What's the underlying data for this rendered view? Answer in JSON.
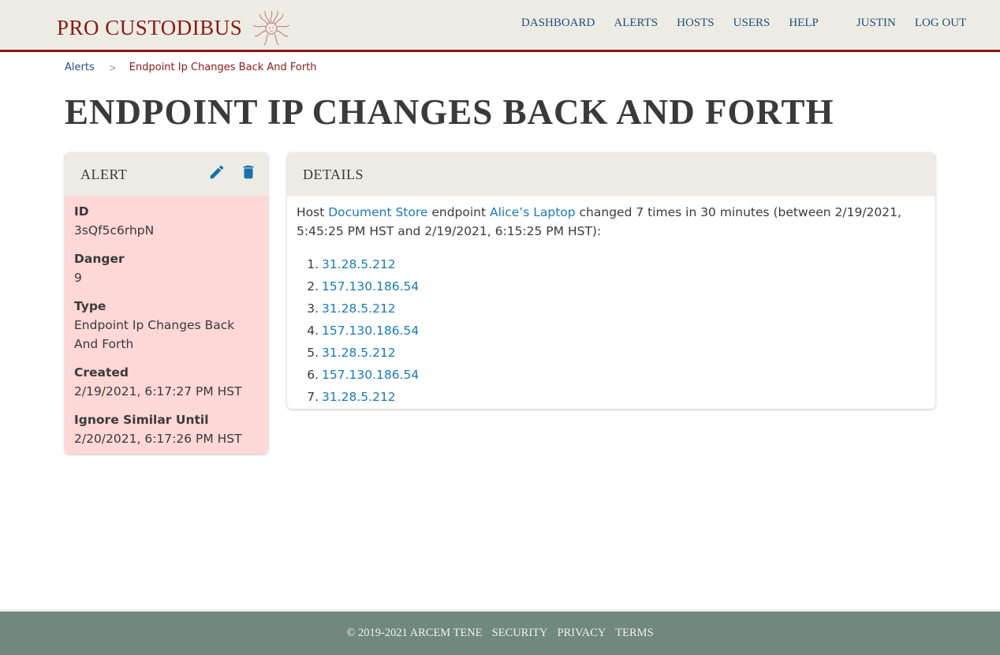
{
  "brand": {
    "name": "PRO CUSTODIBUS",
    "emblem_icon": "medusa-head-icon",
    "color": "#8a1a16"
  },
  "nav": {
    "items": [
      {
        "label": "DASHBOARD"
      },
      {
        "label": "ALERTS"
      },
      {
        "label": "HOSTS"
      },
      {
        "label": "USERS"
      },
      {
        "label": "HELP"
      }
    ],
    "user": "JUSTIN",
    "logout": "LOG OUT"
  },
  "breadcrumb": {
    "parent": "Alerts",
    "separator": ">",
    "current": "Endpoint Ip Changes Back And Forth"
  },
  "page_title": "ENDPOINT IP CHANGES BACK AND FORTH",
  "alert_card": {
    "title": "ALERT",
    "edit_icon": "pencil-icon",
    "delete_icon": "trash-icon",
    "background": "#fed7d7",
    "fields": [
      {
        "label": "ID",
        "value": "3sQf5c6rhpN"
      },
      {
        "label": "Danger",
        "value": "9"
      },
      {
        "label": "Type",
        "value": "Endpoint Ip Changes Back And Forth"
      },
      {
        "label": "Created",
        "value": "2/19/2021, 6:17:27 PM HST"
      },
      {
        "label": "Ignore Similar Until",
        "value": "2/20/2021, 6:17:26 PM HST"
      }
    ]
  },
  "details_card": {
    "title": "DETAILS",
    "sentence": {
      "prefix": "Host ",
      "host_link": "Document Store",
      "middle": " endpoint ",
      "endpoint_link": "Alice’s Laptop",
      "suffix": " changed 7 times in 30 minutes (between 2/19/2021, 5:45:25 PM HST and 2/19/2021, 6:15:25 PM HST):"
    },
    "ip_changes": [
      {
        "num": "1.",
        "ip": "31.28.5.212"
      },
      {
        "num": "2.",
        "ip": "157.130.186.54"
      },
      {
        "num": "3.",
        "ip": "31.28.5.212"
      },
      {
        "num": "4.",
        "ip": "157.130.186.54"
      },
      {
        "num": "5.",
        "ip": "31.28.5.212"
      },
      {
        "num": "6.",
        "ip": "157.130.186.54"
      },
      {
        "num": "7.",
        "ip": "31.28.5.212"
      }
    ]
  },
  "footer": {
    "copyright": "© 2019-2021 ARCEM TENE",
    "links": [
      "SECURITY",
      "PRIVACY",
      "TERMS"
    ]
  },
  "colors": {
    "nav_link": "#1f4f7e",
    "link": "#1a7ab6",
    "header_bg": "#edece4",
    "footer_bg": "#70887d",
    "accent_red": "#8a1a16"
  }
}
